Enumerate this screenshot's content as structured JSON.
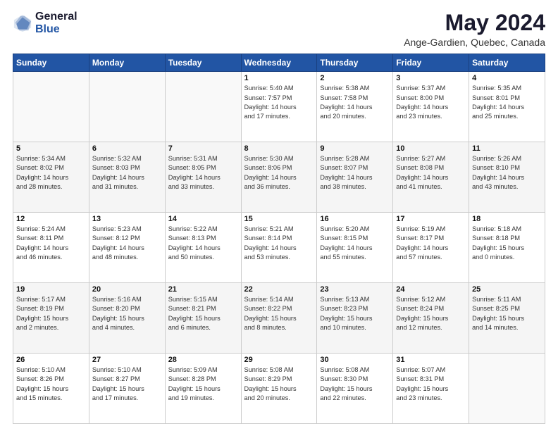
{
  "header": {
    "logo": {
      "general": "General",
      "blue": "Blue"
    },
    "title": "May 2024",
    "subtitle": "Ange-Gardien, Quebec, Canada"
  },
  "calendar": {
    "days_of_week": [
      "Sunday",
      "Monday",
      "Tuesday",
      "Wednesday",
      "Thursday",
      "Friday",
      "Saturday"
    ],
    "weeks": [
      [
        {
          "day": "",
          "info": ""
        },
        {
          "day": "",
          "info": ""
        },
        {
          "day": "",
          "info": ""
        },
        {
          "day": "1",
          "info": "Sunrise: 5:40 AM\nSunset: 7:57 PM\nDaylight: 14 hours\nand 17 minutes."
        },
        {
          "day": "2",
          "info": "Sunrise: 5:38 AM\nSunset: 7:58 PM\nDaylight: 14 hours\nand 20 minutes."
        },
        {
          "day": "3",
          "info": "Sunrise: 5:37 AM\nSunset: 8:00 PM\nDaylight: 14 hours\nand 23 minutes."
        },
        {
          "day": "4",
          "info": "Sunrise: 5:35 AM\nSunset: 8:01 PM\nDaylight: 14 hours\nand 25 minutes."
        }
      ],
      [
        {
          "day": "5",
          "info": "Sunrise: 5:34 AM\nSunset: 8:02 PM\nDaylight: 14 hours\nand 28 minutes."
        },
        {
          "day": "6",
          "info": "Sunrise: 5:32 AM\nSunset: 8:03 PM\nDaylight: 14 hours\nand 31 minutes."
        },
        {
          "day": "7",
          "info": "Sunrise: 5:31 AM\nSunset: 8:05 PM\nDaylight: 14 hours\nand 33 minutes."
        },
        {
          "day": "8",
          "info": "Sunrise: 5:30 AM\nSunset: 8:06 PM\nDaylight: 14 hours\nand 36 minutes."
        },
        {
          "day": "9",
          "info": "Sunrise: 5:28 AM\nSunset: 8:07 PM\nDaylight: 14 hours\nand 38 minutes."
        },
        {
          "day": "10",
          "info": "Sunrise: 5:27 AM\nSunset: 8:08 PM\nDaylight: 14 hours\nand 41 minutes."
        },
        {
          "day": "11",
          "info": "Sunrise: 5:26 AM\nSunset: 8:10 PM\nDaylight: 14 hours\nand 43 minutes."
        }
      ],
      [
        {
          "day": "12",
          "info": "Sunrise: 5:24 AM\nSunset: 8:11 PM\nDaylight: 14 hours\nand 46 minutes."
        },
        {
          "day": "13",
          "info": "Sunrise: 5:23 AM\nSunset: 8:12 PM\nDaylight: 14 hours\nand 48 minutes."
        },
        {
          "day": "14",
          "info": "Sunrise: 5:22 AM\nSunset: 8:13 PM\nDaylight: 14 hours\nand 50 minutes."
        },
        {
          "day": "15",
          "info": "Sunrise: 5:21 AM\nSunset: 8:14 PM\nDaylight: 14 hours\nand 53 minutes."
        },
        {
          "day": "16",
          "info": "Sunrise: 5:20 AM\nSunset: 8:15 PM\nDaylight: 14 hours\nand 55 minutes."
        },
        {
          "day": "17",
          "info": "Sunrise: 5:19 AM\nSunset: 8:17 PM\nDaylight: 14 hours\nand 57 minutes."
        },
        {
          "day": "18",
          "info": "Sunrise: 5:18 AM\nSunset: 8:18 PM\nDaylight: 15 hours\nand 0 minutes."
        }
      ],
      [
        {
          "day": "19",
          "info": "Sunrise: 5:17 AM\nSunset: 8:19 PM\nDaylight: 15 hours\nand 2 minutes."
        },
        {
          "day": "20",
          "info": "Sunrise: 5:16 AM\nSunset: 8:20 PM\nDaylight: 15 hours\nand 4 minutes."
        },
        {
          "day": "21",
          "info": "Sunrise: 5:15 AM\nSunset: 8:21 PM\nDaylight: 15 hours\nand 6 minutes."
        },
        {
          "day": "22",
          "info": "Sunrise: 5:14 AM\nSunset: 8:22 PM\nDaylight: 15 hours\nand 8 minutes."
        },
        {
          "day": "23",
          "info": "Sunrise: 5:13 AM\nSunset: 8:23 PM\nDaylight: 15 hours\nand 10 minutes."
        },
        {
          "day": "24",
          "info": "Sunrise: 5:12 AM\nSunset: 8:24 PM\nDaylight: 15 hours\nand 12 minutes."
        },
        {
          "day": "25",
          "info": "Sunrise: 5:11 AM\nSunset: 8:25 PM\nDaylight: 15 hours\nand 14 minutes."
        }
      ],
      [
        {
          "day": "26",
          "info": "Sunrise: 5:10 AM\nSunset: 8:26 PM\nDaylight: 15 hours\nand 15 minutes."
        },
        {
          "day": "27",
          "info": "Sunrise: 5:10 AM\nSunset: 8:27 PM\nDaylight: 15 hours\nand 17 minutes."
        },
        {
          "day": "28",
          "info": "Sunrise: 5:09 AM\nSunset: 8:28 PM\nDaylight: 15 hours\nand 19 minutes."
        },
        {
          "day": "29",
          "info": "Sunrise: 5:08 AM\nSunset: 8:29 PM\nDaylight: 15 hours\nand 20 minutes."
        },
        {
          "day": "30",
          "info": "Sunrise: 5:08 AM\nSunset: 8:30 PM\nDaylight: 15 hours\nand 22 minutes."
        },
        {
          "day": "31",
          "info": "Sunrise: 5:07 AM\nSunset: 8:31 PM\nDaylight: 15 hours\nand 23 minutes."
        },
        {
          "day": "",
          "info": ""
        }
      ]
    ]
  }
}
